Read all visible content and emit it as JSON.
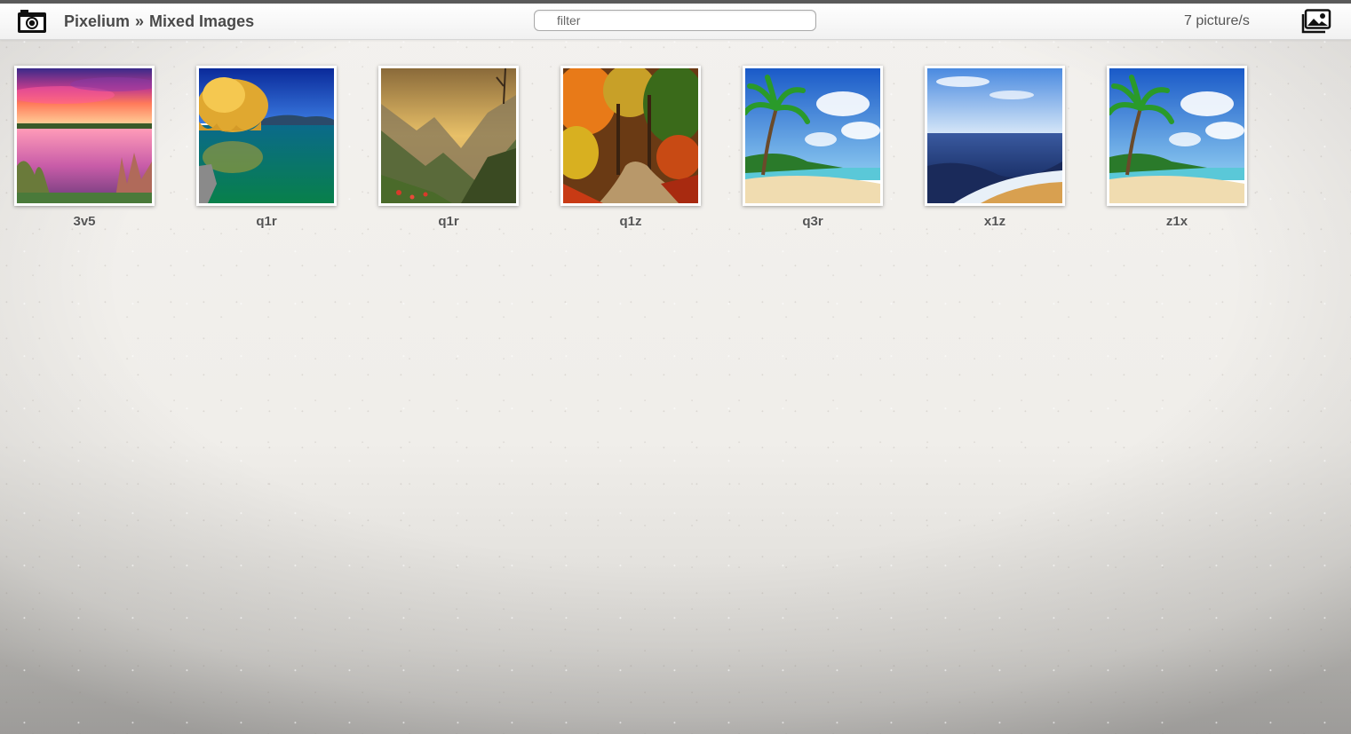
{
  "header": {
    "app_name": "Pixelium",
    "separator": "»",
    "album": "Mixed Images",
    "filter_placeholder": "filter",
    "filter_value": "",
    "count": "7 picture/s"
  },
  "icons": {
    "app": "camera-icon",
    "gallery": "gallery-icon"
  },
  "colors": {
    "header_bg": "#f1f1f1",
    "topline": "#5a5a5a",
    "text": "#4a4a4a"
  },
  "pictures": [
    {
      "label": "3v5",
      "scene": "pink-sunset-lake"
    },
    {
      "label": "q1r",
      "scene": "yellow-willow-lake"
    },
    {
      "label": "q1r",
      "scene": "golden-mountain-valley"
    },
    {
      "label": "q1z",
      "scene": "autumn-forest-path"
    },
    {
      "label": "q3r",
      "scene": "tropical-beach-palm"
    },
    {
      "label": "x1z",
      "scene": "ocean-shore-waves"
    },
    {
      "label": "z1x",
      "scene": "tropical-beach-palm"
    }
  ]
}
